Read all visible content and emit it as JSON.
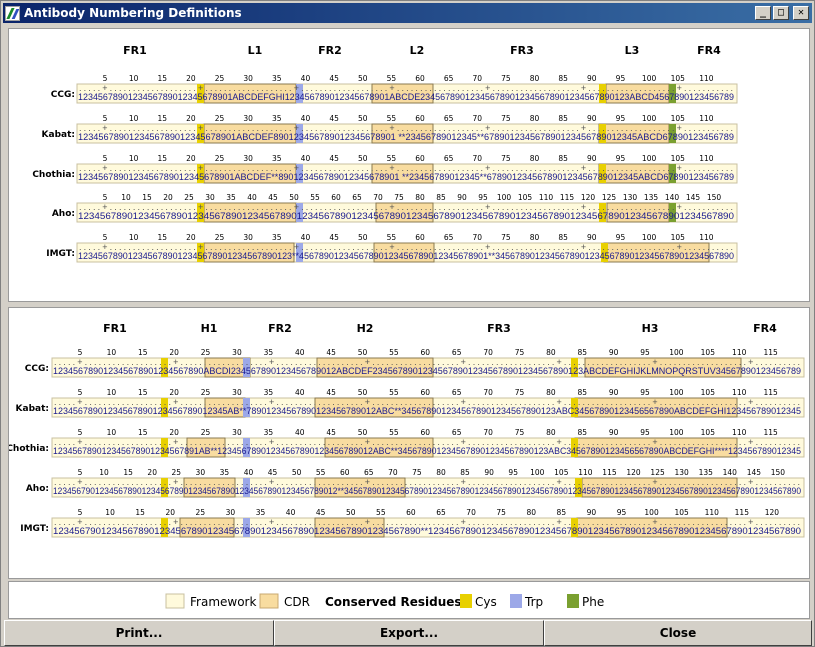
{
  "window": {
    "title": "Antibody Numbering Definitions"
  },
  "buttons": {
    "minimize": "_",
    "maximize": "□",
    "close": "✕",
    "print": "Print...",
    "export": "Export...",
    "close_main": "Close"
  },
  "colors": {
    "framework": "#fffadc",
    "cdr": "#f8dca0",
    "cys": "#e8d000",
    "trp": "#9ca8e8",
    "phe": "#7aa030",
    "num": "#1a1a8e"
  },
  "legend": {
    "framework": "Framework",
    "cdr": "CDR",
    "conserved": "Conserved Residues:",
    "cys": "Cys",
    "trp": "Trp",
    "phe": "Phe"
  },
  "light": {
    "regions": [
      "FR1",
      "L1",
      "FR2",
      "L2",
      "FR3",
      "L3",
      "FR4"
    ],
    "rows": [
      {
        "label": "CCG:",
        "ticks": [
          "5",
          "10",
          "15",
          "20",
          "25",
          "30",
          "35",
          "40",
          "45",
          "50",
          "55",
          "60",
          "65",
          "70",
          "75",
          "80",
          "85",
          "90",
          "95",
          "100",
          "105",
          "110"
        ],
        "seq": "1234567890123456789012345678901ABCDEFGHI123456789012345678901ABCDE234567890123456789012345678901234567890123ABCD4567890123456789"
      },
      {
        "label": "Kabat:",
        "ticks": [
          "5",
          "10",
          "15",
          "20",
          "25",
          "30",
          "35",
          "40",
          "45",
          "50",
          "55",
          "60",
          "65",
          "70",
          "75",
          "80",
          "85",
          "90",
          "95",
          "100",
          "105",
          "110"
        ],
        "seq": "1234567890123456789012345678901ABCDEF890123456789012345678901 **23456789012345**678901234567890123456789012345ABCD67890123456789"
      },
      {
        "label": "Chothia:",
        "ticks": [
          "5",
          "10",
          "15",
          "20",
          "25",
          "30",
          "35",
          "40",
          "45",
          "50",
          "55",
          "60",
          "65",
          "70",
          "75",
          "80",
          "85",
          "90",
          "95",
          "100",
          "105",
          "110"
        ],
        "seq": "1234567890123456789012345678901ABCDEF**890123456789012345678901 **23456789012345**678901234567890123456789012345ABCD67890123456789"
      },
      {
        "label": "Aho:",
        "ticks": [
          "5",
          "10",
          "15",
          "20",
          "25",
          "30",
          "35",
          "40",
          "45",
          "50",
          "55",
          "60",
          "65",
          "70",
          "75",
          "80",
          "85",
          "90",
          "95",
          "100",
          "105",
          "110",
          "115",
          "120",
          "125",
          "130",
          "135",
          "140",
          "145",
          "150"
        ],
        "seq": "123456789012345678901234567890123456789012345678901234567890123456789012345678901234567890123456789012345678901234567890"
      },
      {
        "label": "IMGT:",
        "ticks": [
          "5",
          "10",
          "15",
          "20",
          "25",
          "30",
          "35",
          "40",
          "45",
          "50",
          "55",
          "60",
          "65",
          "70",
          "75",
          "80",
          "85",
          "90",
          "95",
          "100",
          "105",
          "110"
        ],
        "seq": "1234567890123456789012345678901234567890123**45678901234567890123456789012345678901**345678901234567890123456789012345678901234567890"
      }
    ]
  },
  "heavy": {
    "regions": [
      "FR1",
      "H1",
      "FR2",
      "H2",
      "FR3",
      "H3",
      "FR4"
    ],
    "rows": [
      {
        "label": "CCG:",
        "ticks": [
          "5",
          "10",
          "15",
          "20",
          "25",
          "30",
          "35",
          "40",
          "45",
          "50",
          "55",
          "60",
          "65",
          "70",
          "75",
          "80",
          "85",
          "90",
          "95",
          "100",
          "105",
          "110",
          "115"
        ],
        "seq": "123456789012345678901234567890ABCDI234567890123456789012ABCDEF234567890123456789012345678901234567890123ABCDEFGHIJKLMNOPQRSTUV34567890123456789"
      },
      {
        "label": "Kabat:",
        "ticks": [
          "5",
          "10",
          "15",
          "20",
          "25",
          "30",
          "35",
          "40",
          "45",
          "50",
          "55",
          "60",
          "65",
          "70",
          "75",
          "80",
          "85",
          "90",
          "95",
          "100",
          "105",
          "110",
          "115"
        ],
        "seq": "12345678901234567890123456789012345AB**78901234567890123456789012ABC**3456789012345678901234567890123ABC34567890123456567890ABCDEFGHI123456789012345"
      },
      {
        "label": "Chothia:",
        "ticks": [
          "5",
          "10",
          "15",
          "20",
          "25",
          "30",
          "35",
          "40",
          "45",
          "50",
          "55",
          "60",
          "65",
          "70",
          "75",
          "80",
          "85",
          "90",
          "95",
          "100",
          "105",
          "110",
          "115"
        ],
        "seq": "123456789012345678901234567891AB**12345678901234567890123456789012ABC**3456789012345678901234567890123ABC34567890123456567890ABCDEFGHI****123456789012345"
      },
      {
        "label": "Aho:",
        "ticks": [
          "5",
          "10",
          "15",
          "20",
          "25",
          "30",
          "35",
          "40",
          "45",
          "50",
          "55",
          "60",
          "65",
          "70",
          "75",
          "80",
          "85",
          "90",
          "95",
          "100",
          "105",
          "110",
          "115",
          "120",
          "125",
          "130",
          "135",
          "140",
          "145",
          "150"
        ],
        "seq": "1234567901234567890123456789012345678901234567890123456789012**34567890123456789012345678901234567890123456789012345678901234567890123456789012345678901234567890"
      },
      {
        "label": "IMGT:",
        "ticks": [
          "5",
          "10",
          "15",
          "20",
          "25",
          "30",
          "35",
          "40",
          "45",
          "50",
          "55",
          "60",
          "65",
          "70",
          "75",
          "80",
          "85",
          "90",
          "95",
          "100",
          "105",
          "110",
          "115",
          "120"
        ],
        "seq": "123456790123456789012345678901234567890123456789012345678901234567890**1234567890123456789012345678901234567890123456789012345678901234567890"
      }
    ]
  }
}
